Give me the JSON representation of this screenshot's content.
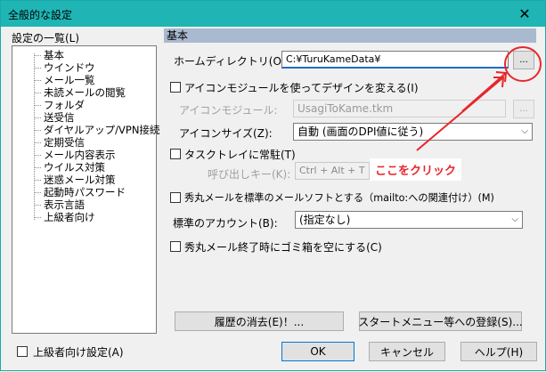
{
  "window": {
    "title": "全般的な設定",
    "close_glyph": "✕"
  },
  "tree": {
    "label": "設定の一覧(L)",
    "items": [
      "基本",
      "ウインドウ",
      "メール一覧",
      "未読メールの閲覧",
      "フォルダ",
      "送受信",
      "ダイヤルアップ/VPN接続",
      "定期受信",
      "メール内容表示",
      "ウイルス対策",
      "迷惑メール対策",
      "起動時パスワード",
      "表示言語",
      "上級者向け"
    ],
    "advanced_checkbox": "上級者向け設定(A)"
  },
  "panel": {
    "section": "基本",
    "home_dir_label": "ホームディレクトリ(O):",
    "home_dir_value": "C:¥TuruKameData¥",
    "browse_label": "...",
    "icon_module_check": "アイコンモジュールを使ってデザインを変える(I)",
    "icon_module_label": "アイコンモジュール:",
    "icon_module_value": "UsagiToKame.tkm",
    "icon_size_label": "アイコンサイズ(Z):",
    "icon_size_value": "自動 (画面のDPI値に従う)",
    "tasktray_check": "タスクトレイに常駐(T)",
    "hotkey_label": "呼び出しキー(K):",
    "hotkey_value": "Ctrl + Alt + T",
    "default_mailer_check": "秀丸メールを標準のメールソフトとする（mailto:への関連付け）(M)",
    "account_label": "標準のアカウント(B):",
    "account_value": "(指定なし)",
    "trash_check": "秀丸メール終了時にゴミ箱を空にする(C)",
    "clear_history_btn": "履歴の消去(E)！...",
    "startmenu_btn": "スタートメニュー等への登録(S)...",
    "dropdown_arrow": "⌵"
  },
  "footer": {
    "ok": "OK",
    "cancel": "キャンセル",
    "help": "ヘルプ(H)"
  },
  "annotation": {
    "text": "ここをクリック",
    "color": "#e8262a"
  }
}
